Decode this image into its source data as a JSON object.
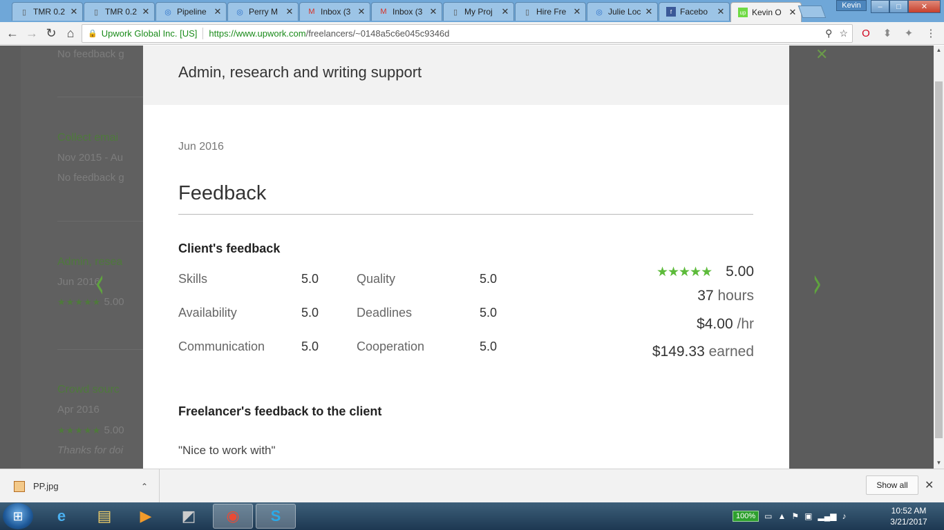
{
  "browser": {
    "tabs": [
      {
        "title": "TMR 0.2",
        "icon": "page-icon"
      },
      {
        "title": "TMR 0.2",
        "icon": "page-icon"
      },
      {
        "title": "Pipeline",
        "icon": "blue-swirl-icon"
      },
      {
        "title": "Perry M",
        "icon": "blue-swirl-icon"
      },
      {
        "title": "Inbox (3",
        "icon": "gmail-icon"
      },
      {
        "title": "Inbox (3",
        "icon": "gmail-icon"
      },
      {
        "title": "My Proj",
        "icon": "page-icon"
      },
      {
        "title": "Hire Fre",
        "icon": "page-icon"
      },
      {
        "title": "Julie Loc",
        "icon": "blue-swirl-icon"
      },
      {
        "title": "Facebo",
        "icon": "facebook-icon"
      },
      {
        "title": "Kevin O",
        "icon": "upwork-icon"
      }
    ],
    "profile_name": "Kevin",
    "site_identity": "Upwork Global Inc. [US]",
    "url_prefix": "https://www.upwork.com",
    "url_rest": "/freelancers/~0148a5c6e045c9346d"
  },
  "background_list": {
    "items": [
      {
        "sub": "No feedback g"
      },
      {
        "title": "Collect emai",
        "sub": "Nov 2015 - Au",
        "sub2": "No feedback g"
      },
      {
        "title": "Admin, resea",
        "sub": "Jun 2016",
        "rating": "5.00"
      },
      {
        "title": "Crowd sourc",
        "sub": "Apr 2016",
        "rating": "5.00",
        "sub2": "Thanks for doi"
      }
    ]
  },
  "modal": {
    "title": "Admin, research and writing support",
    "date": "Jun 2016",
    "feedback_heading": "Feedback",
    "client_feedback_heading": "Client's feedback",
    "scores": [
      {
        "label": "Skills",
        "value": "5.0"
      },
      {
        "label": "Quality",
        "value": "5.0"
      },
      {
        "label": "Availability",
        "value": "5.0"
      },
      {
        "label": "Deadlines",
        "value": "5.0"
      },
      {
        "label": "Communication",
        "value": "5.0"
      },
      {
        "label": "Cooperation",
        "value": "5.0"
      }
    ],
    "overall_rating": "5.00",
    "star_count": 5,
    "hours_value": "37",
    "hours_unit": "hours",
    "rate_value": "$4.00",
    "rate_unit": "/hr",
    "earned_value": "$149.33",
    "earned_unit": "earned",
    "freelancer_feedback_heading": "Freelancer's feedback to the client",
    "freelancer_quote": "\"Nice to work with\""
  },
  "downloads": {
    "file_name": "PP.jpg",
    "show_all_label": "Show all"
  },
  "taskbar": {
    "battery": "100%",
    "time": "10:52 AM",
    "date": "3/21/2017"
  },
  "colors": {
    "star_green": "#5dbb3b",
    "upwork_green": "#6fda44"
  }
}
